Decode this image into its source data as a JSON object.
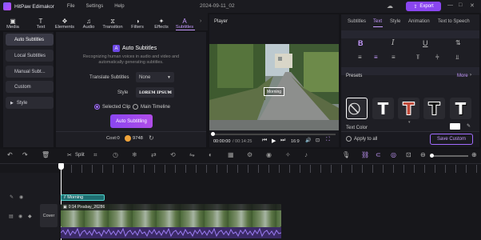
{
  "app": {
    "name": "HitPaw Edimakor",
    "menu": [
      "File",
      "Settings",
      "Help"
    ],
    "project": "2024-09-11_02",
    "export": "Export"
  },
  "toolbar": [
    {
      "label": "Media",
      "icon": "media-icon"
    },
    {
      "label": "Text",
      "icon": "text-icon"
    },
    {
      "label": "Elements",
      "icon": "elements-icon"
    },
    {
      "label": "Audio",
      "icon": "audio-icon"
    },
    {
      "label": "Transition",
      "icon": "transition-icon"
    },
    {
      "label": "Filters",
      "icon": "filters-icon"
    },
    {
      "label": "Effects",
      "icon": "effects-icon"
    },
    {
      "label": "Subtitles",
      "icon": "subtitles-icon"
    }
  ],
  "leftnav": {
    "items": [
      "Auto Subtitles",
      "Local Subtitles",
      "Manual Subt...",
      "Custom",
      "Style"
    ]
  },
  "auto": {
    "title": "Auto Subtitles",
    "desc1": "Recognizing human voices in audio and video and",
    "desc2": "automatically generating subtitles.",
    "translate_label": "Translate Subtitles",
    "translate_value": "None",
    "style_label": "Style",
    "style_value": "LOREM IPSUM",
    "radio1": "Selected Clip",
    "radio2": "Main Timeline",
    "button": "Auto Subtitling",
    "cost_label": "Cost:0",
    "coins": "9748"
  },
  "player": {
    "title": "Player",
    "current": "00:00:00",
    "total": "/ 00:14:25",
    "ratio": "16:9",
    "subtitle_text": "Morning"
  },
  "props": {
    "tabs": [
      "Subtitles",
      "Text",
      "Style",
      "Animation",
      "Text to Speech"
    ],
    "active_tab": "Text",
    "presets_label": "Presets",
    "more": "More",
    "text_color": "Text Color",
    "apply_all": "Apply to all",
    "save_custom": "Save Custom"
  },
  "timeline": {
    "split": "Split",
    "subtitle_clip": "Morning",
    "video_clip": "0:14 Pixabay_26286",
    "cover": "Cover"
  }
}
